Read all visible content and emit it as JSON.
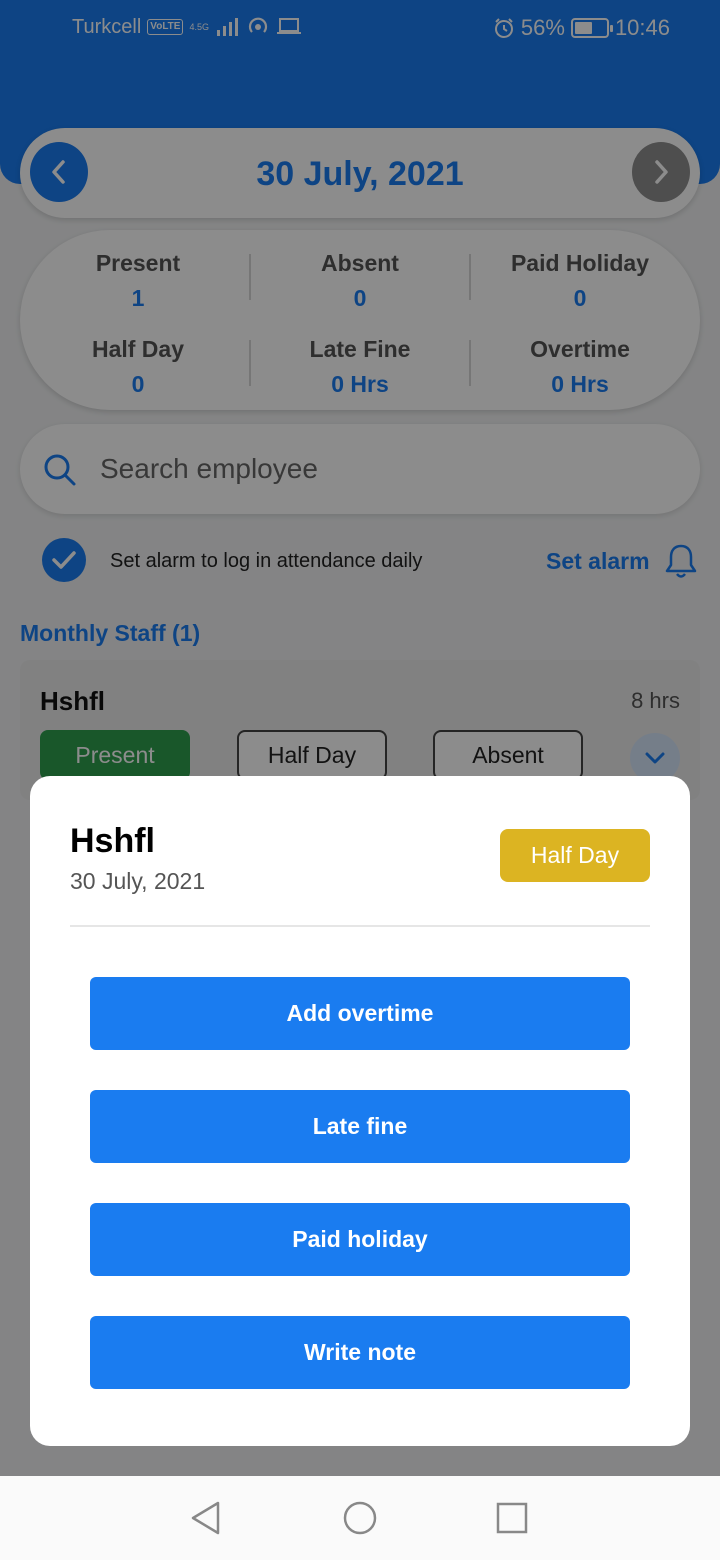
{
  "status_bar": {
    "carrier": "Turkcell",
    "volte": "VoLTE",
    "network": "4.5G",
    "battery": "56%",
    "battery_level": 0.56,
    "time": "10:46"
  },
  "header": {
    "date": "30 July, 2021"
  },
  "stats": [
    {
      "label": "Present",
      "value": "1"
    },
    {
      "label": "Absent",
      "value": "0"
    },
    {
      "label": "Paid Holiday",
      "value": "0"
    },
    {
      "label": "Half Day",
      "value": "0"
    },
    {
      "label": "Late Fine",
      "value": "0 Hrs"
    },
    {
      "label": "Overtime",
      "value": "0 Hrs"
    }
  ],
  "search": {
    "placeholder": "Search employee"
  },
  "alarm": {
    "text": "Set alarm to log in attendance daily",
    "button_label": "Set alarm"
  },
  "section": {
    "title": "Monthly Staff (1)"
  },
  "staff": {
    "name": "Hshfl",
    "hours": "8 hrs",
    "buttons": [
      "Present",
      "Half Day",
      "Absent"
    ]
  },
  "modal": {
    "name": "Hshfl",
    "date": "30 July, 2021",
    "badge": "Half Day",
    "actions": [
      "Add overtime",
      "Late fine",
      "Paid holiday",
      "Write note"
    ]
  },
  "colors": {
    "primary": "#1a7cf0",
    "present": "#2e9e4d",
    "half_day_badge": "#dcb422"
  }
}
